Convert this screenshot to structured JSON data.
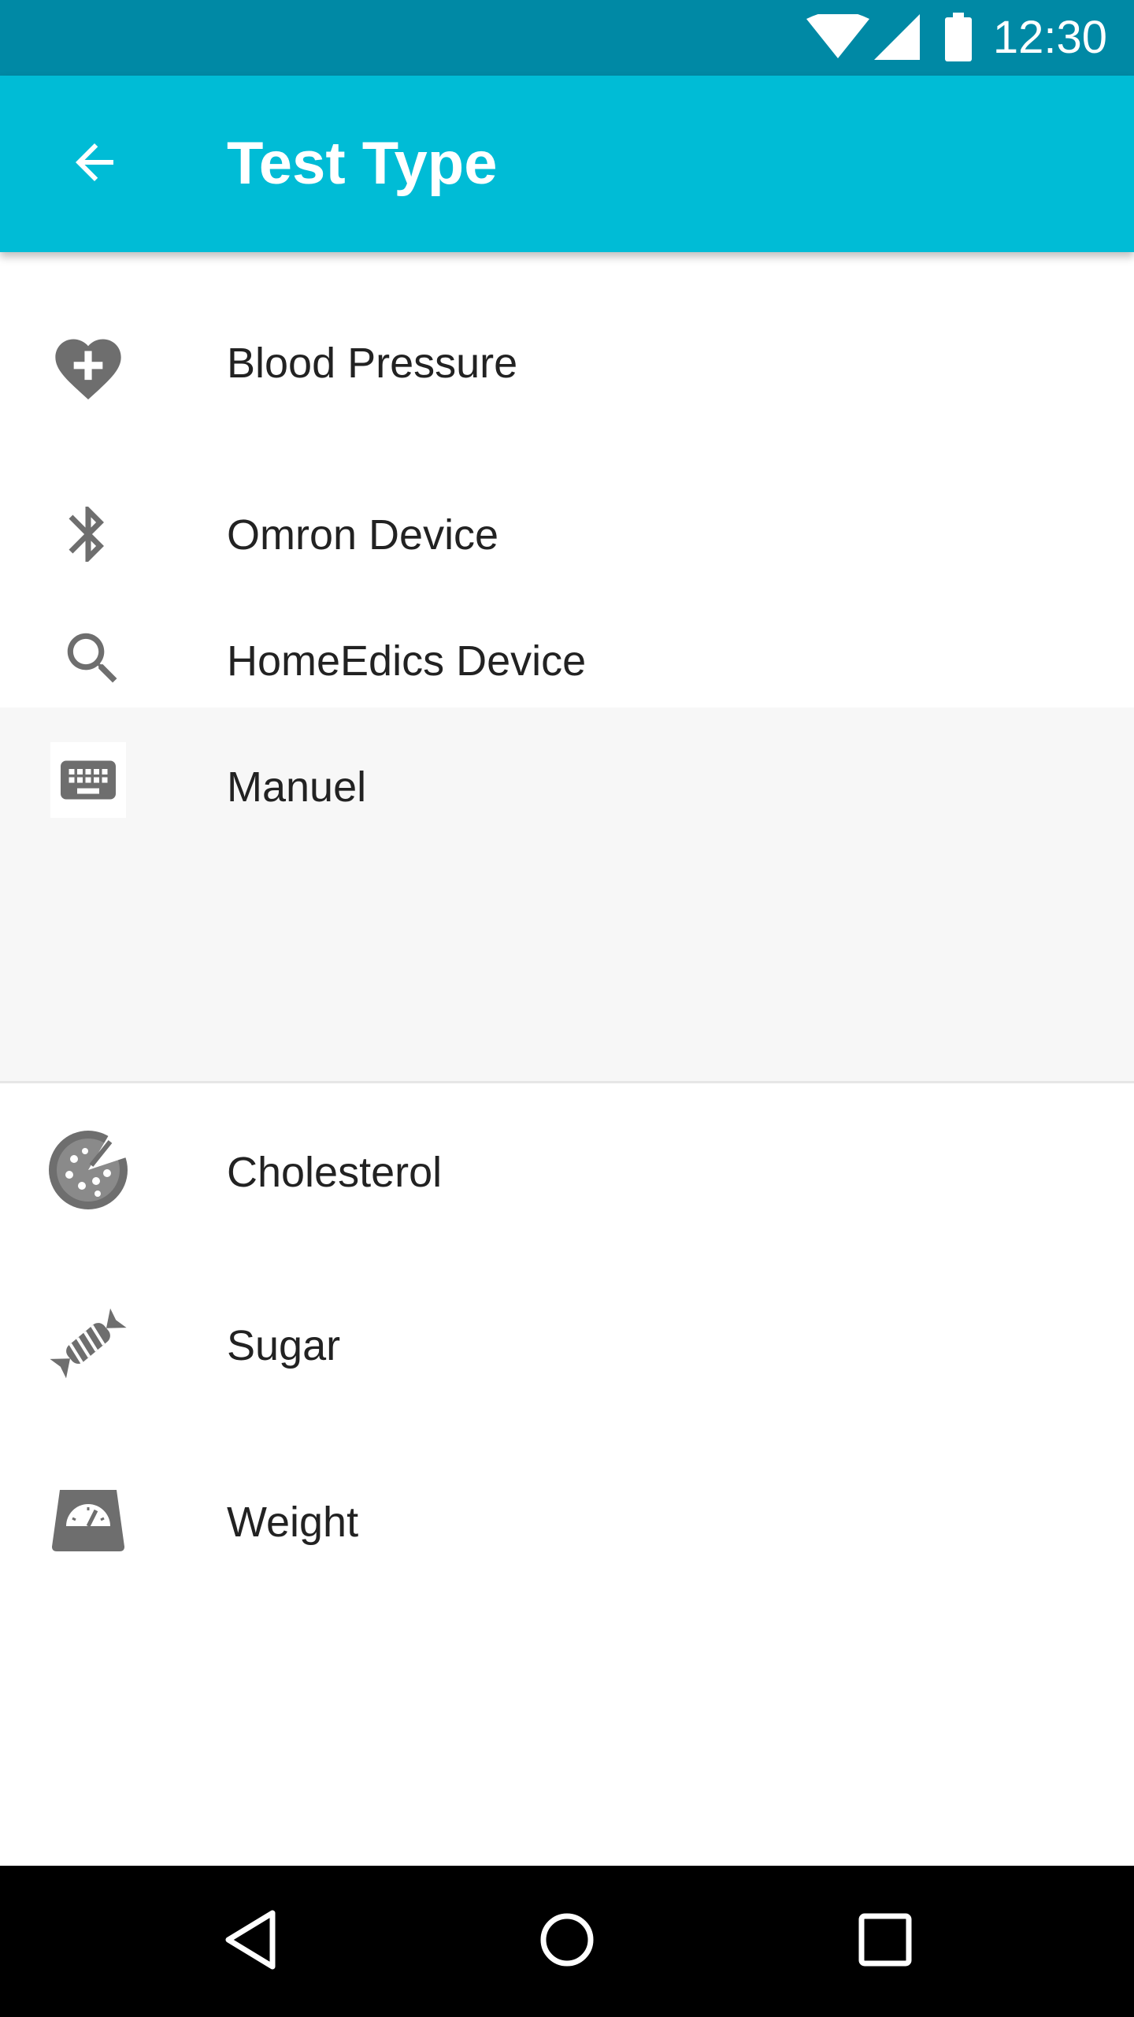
{
  "status_bar": {
    "time": "12:30",
    "icons": [
      "wifi-icon",
      "signal-icon",
      "battery-icon"
    ]
  },
  "app_bar": {
    "title": "Test Type",
    "back_icon": "arrow-back-icon",
    "background": "#00bcd6",
    "status_background": "#0089a5"
  },
  "list": {
    "items": [
      {
        "label": "Blood Pressure",
        "icon": "heart-plus-icon"
      },
      {
        "label": "Omron Device",
        "icon": "bluetooth-icon"
      },
      {
        "label": "HomeEdics Device",
        "icon": "search-icon"
      },
      {
        "label": "Manuel",
        "icon": "keyboard-icon"
      },
      {
        "label": "Cholesterol",
        "icon": "pizza-icon"
      },
      {
        "label": "Sugar",
        "icon": "candy-icon"
      },
      {
        "label": "Weight",
        "icon": "scale-icon"
      }
    ]
  },
  "nav_bar": {
    "icons": [
      "back-triangle-icon",
      "home-circle-icon",
      "recents-square-icon"
    ]
  },
  "colors": {
    "icon_gray": "#6e6e6e",
    "text": "#222222",
    "submenu_bg": "#f7f7f7"
  }
}
